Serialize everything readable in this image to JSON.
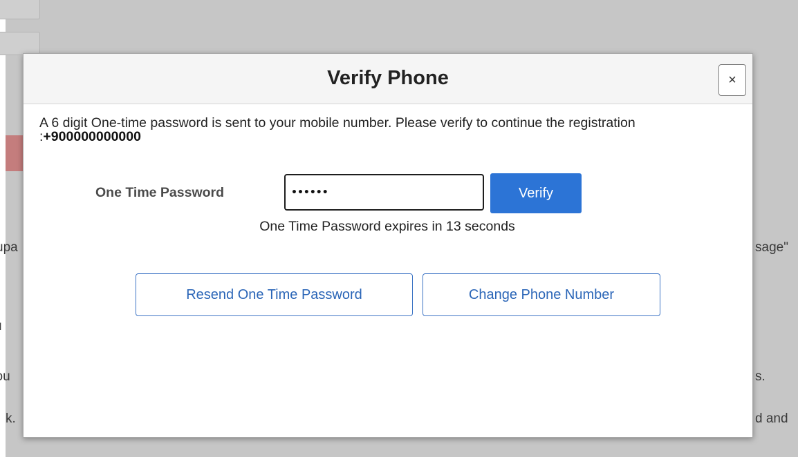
{
  "background": {
    "fragments": [
      "upa",
      "sage\"",
      "u",
      "you",
      "s.",
      "k.",
      "d and"
    ]
  },
  "modal": {
    "title": "Verify Phone",
    "close_symbol": "×",
    "close_icon": "close-icon",
    "intro_text": "A 6 digit One-time password is sent to your mobile number. Please verify to continue the registration :",
    "phone_number": "+900000000000",
    "otp_label": "One Time Password",
    "otp_value": "••••••",
    "verify_label": "Verify",
    "expiry_text": "One Time Password expires in 13 seconds",
    "resend_label": "Resend One Time Password",
    "change_label": "Change Phone Number"
  },
  "colors": {
    "primary": "#2c74d6",
    "outline_text": "#2a65b7",
    "overlay": "#c6c6c6"
  }
}
